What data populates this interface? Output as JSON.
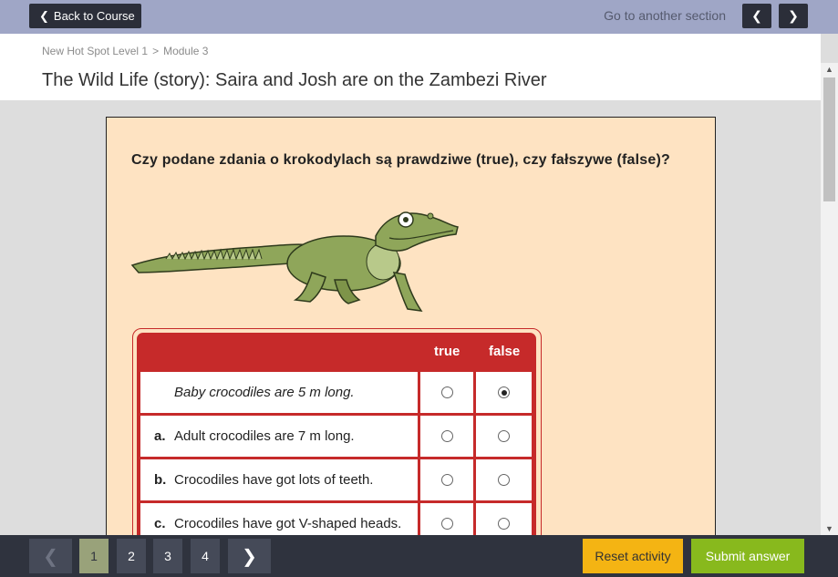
{
  "topbar": {
    "back_label": "Back to Course",
    "goto_label": "Go to another section",
    "prev_icon": "chevron-left",
    "next_icon": "chevron-right"
  },
  "breadcrumb": {
    "course": "New Hot Spot Level 1",
    "separator": ">",
    "module": "Module 3"
  },
  "page_title": "The Wild Life (story): Saira and Josh are on the Zambezi River",
  "activity": {
    "instruction": "Czy podane zdania o krokodylach są prawdziwe (true), czy fałszywe (false)?",
    "illustration": "crocodile",
    "columns": {
      "true_label": "true",
      "false_label": "false"
    },
    "rows": [
      {
        "label": "",
        "text": "Baby crocodiles are 5 m long.",
        "example": true,
        "selected": "false"
      },
      {
        "label": "a.",
        "text": "Adult crocodiles are 7 m long.",
        "example": false,
        "selected": null
      },
      {
        "label": "b.",
        "text": "Crocodiles have got lots of teeth.",
        "example": false,
        "selected": null
      },
      {
        "label": "c.",
        "text": "Crocodiles have got V-shaped heads.",
        "example": false,
        "selected": null
      }
    ]
  },
  "footer": {
    "pages": [
      "1",
      "2",
      "3",
      "4"
    ],
    "current_page": "1",
    "reset_label": "Reset activity",
    "submit_label": "Submit answer"
  },
  "colors": {
    "topbar": "#9fa6c6",
    "dark_button": "#2b2e39",
    "panel_bg": "#fee3c2",
    "table_red": "#c62a2a",
    "reset": "#f4b413",
    "submit": "#88b91d",
    "active_page": "#99a27a"
  }
}
